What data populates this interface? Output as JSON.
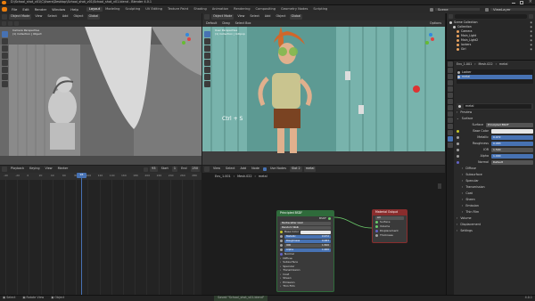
{
  "window": {
    "title": "D:\\School_shot_v01\\C\\Users\\Desktop\\School_shot_v01\\School_shot_v01.blend - Blender 4.0.1"
  },
  "menu": {
    "items": [
      "File",
      "Edit",
      "Render",
      "Window",
      "Help"
    ]
  },
  "workspaces": {
    "tabs": [
      "Layout",
      "Modeling",
      "Sculpting",
      "UV Editing",
      "Texture Paint",
      "Shading",
      "Animation",
      "Rendering",
      "Compositing",
      "Geometry Nodes",
      "Scripting"
    ],
    "active": "Layout"
  },
  "topright": {
    "scene_label": "Scene",
    "view_layer_label": "ViewLayer"
  },
  "viewport_left": {
    "mode": "Object Mode",
    "menus": [
      "View",
      "Select",
      "Add",
      "Object"
    ],
    "transform": "Global",
    "overlay_text": "Camera Perspective",
    "overlay_sub": "(1) Collection | Object"
  },
  "viewport_right": {
    "mode": "Object Mode",
    "menus": [
      "View",
      "Select",
      "Add",
      "Object"
    ],
    "transform": "Global",
    "orient": "Default",
    "drag": "Drag",
    "select": "Select Box",
    "options_label": "Options",
    "overlay_text": "User Perspective",
    "overlay_sub": "(1) Collection | lollipop",
    "shortcut_text": "Ctrl + S"
  },
  "outliner": {
    "header": "Scene Collection",
    "items": [
      {
        "label": "Scene Collection",
        "depth": 0
      },
      {
        "label": "Collection",
        "depth": 1
      },
      {
        "label": "Camera",
        "depth": 2
      },
      {
        "label": "Main_Light",
        "depth": 2
      },
      {
        "label": "Main_Light2",
        "depth": 2
      },
      {
        "label": "lockers",
        "depth": 2
      },
      {
        "label": "Girl",
        "depth": 2
      }
    ]
  },
  "properties": {
    "breadcrumb": [
      "Env_1.001",
      "Mesh.022",
      "metal"
    ],
    "slots": [
      "Locker",
      "metal"
    ],
    "material_name": "metal",
    "sections": {
      "preview": "Preview",
      "surface": "Surface"
    },
    "surface_label": "Surface",
    "surface_value": "Principled BSDF",
    "fields": [
      {
        "label": "Base Color",
        "value": "",
        "kind": "color"
      },
      {
        "label": "Metallic",
        "value": "0.972",
        "kind": "blue"
      },
      {
        "label": "Roughness",
        "value": "0.083",
        "kind": "blue"
      },
      {
        "label": "IOR",
        "value": "1.500",
        "kind": "gray"
      },
      {
        "label": "Alpha",
        "value": "1.000",
        "kind": "blue"
      },
      {
        "label": "Normal",
        "value": "Default",
        "kind": "text"
      }
    ],
    "collapsed": [
      "Diffuse",
      "Subsurface",
      "Specular",
      "Transmission",
      "Coat",
      "Sheen",
      "Emission",
      "Thin Film"
    ],
    "footer": [
      "Volume",
      "Displacement",
      "Settings"
    ]
  },
  "timeline": {
    "header": {
      "menus": [
        "Playback",
        "Keying",
        "View",
        "Marker"
      ],
      "start_label": "Start",
      "end_label": "End",
      "start": "1",
      "end": "250",
      "frame": "93"
    },
    "ticks": [
      "-40",
      "-20",
      "0",
      "20",
      "40",
      "60",
      "80",
      "100",
      "120",
      "140",
      "160",
      "180",
      "200",
      "220",
      "240",
      "260",
      "280"
    ],
    "current_frame": "93"
  },
  "node_editor": {
    "header": {
      "menus": [
        "View",
        "Select",
        "Add",
        "Node"
      ],
      "use_nodes_label": "Use Nodes",
      "slot": "Slot 2",
      "material": "metal"
    },
    "breadcrumb": [
      "Env_1.001",
      "Mesh.022",
      "metal"
    ],
    "bsdf": {
      "title": "Principled BSDF",
      "out_label": "BSDF",
      "dist": "Multiscatter GGX",
      "subsurf": "Random Walk",
      "rows": [
        {
          "label": "Base Color",
          "value": "",
          "kind": "color"
        },
        {
          "label": "Metallic",
          "value": "0.972",
          "kind": "blue"
        },
        {
          "label": "Roughness",
          "value": "0.083",
          "kind": "blue"
        },
        {
          "label": "IOR",
          "value": "1.500",
          "kind": "gray"
        },
        {
          "label": "Alpha",
          "value": "1.000",
          "kind": "blue"
        }
      ],
      "normal": "Normal",
      "sub_items": [
        "Diffuse",
        "Subsurface",
        "Specular",
        "Transmission",
        "Coat",
        "Sheen",
        "Emission",
        "Thin Film"
      ]
    },
    "output": {
      "title": "Material Output",
      "target": "All",
      "rows": [
        "Surface",
        "Volume",
        "Displacement",
        "Thickness"
      ]
    }
  },
  "statusbar": {
    "left": [
      "Select",
      "Rotate View",
      "Object"
    ],
    "center": "Saved \"School_shot_v01.blend\"",
    "right": "4.0.1"
  },
  "colors": {
    "accent": "#4772b3",
    "node_green": "#2f6b3b",
    "node_red": "#8a2d2d",
    "locker": "#4a8a83"
  }
}
